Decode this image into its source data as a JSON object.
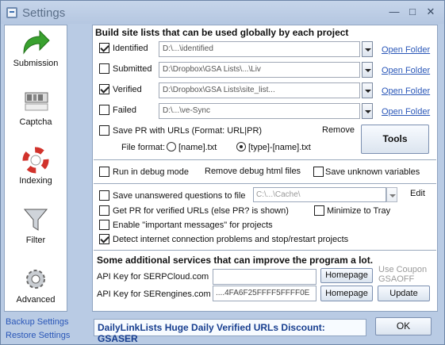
{
  "window": {
    "title": "Settings"
  },
  "sidebar": {
    "items": [
      {
        "label": "Submission",
        "icon": "green-arrow-icon"
      },
      {
        "label": "Captcha",
        "icon": "captcha-icon"
      },
      {
        "label": "Indexing",
        "icon": "lifebuoy-icon"
      },
      {
        "label": "Filter",
        "icon": "funnel-icon"
      },
      {
        "label": "Advanced",
        "icon": "gear-icon"
      }
    ],
    "backup": "Backup Settings",
    "restore": "Restore Settings"
  },
  "sitelists": {
    "header": "Build site lists that can be used globally by each project",
    "rows": [
      {
        "label": "Identified",
        "checked": true,
        "path": "D:\\...\\identified",
        "link": "Open Folder"
      },
      {
        "label": "Submitted",
        "checked": false,
        "path": "D:\\Dropbox\\GSA Lists\\...\\Liv",
        "link": "Open Folder"
      },
      {
        "label": "Verified",
        "checked": true,
        "path": "D:\\Dropbox\\GSA Lists\\site_list...",
        "link": "Open Folder"
      },
      {
        "label": "Failed",
        "checked": false,
        "path": "D:\\...\\ve-Sync",
        "link": "Open Folder"
      }
    ],
    "save_pr": "Save PR with URLs (Format: URL|PR)",
    "remove": "Remove",
    "tools": "Tools",
    "file_format": "File format:",
    "fmt1": "[name].txt",
    "fmt2": "[type]-[name].txt"
  },
  "debug": {
    "run_debug": "Run in debug mode",
    "remove_debug": "Remove debug html files",
    "save_unknown": "Save unknown variables"
  },
  "options": {
    "save_unanswered": "Save unanswered questions to file",
    "save_unanswered_path": "C:\\...\\Cache\\",
    "edit": "Edit",
    "get_pr": "Get PR for verified URLs (else PR? is shown)",
    "minimize": "Minimize to Tray",
    "important": "Enable \"important messages\" for projects",
    "detect": "Detect internet connection problems and stop/restart projects"
  },
  "services": {
    "header": "Some additional services that can improve the program a lot.",
    "serpcloud_label": "API Key for SERPCloud.com",
    "serpcloud_value": "",
    "serengines_label": "API Key for SERengines.com",
    "serengines_value": "....4FA6F25FFFF5FFFF0E",
    "homepage": "Homepage",
    "update": "Update",
    "coupon": "Use Coupon GSAOFF"
  },
  "promo": "DailyLinkLists Huge Daily Verified URLs Discount: GSASER",
  "ok": "OK"
}
